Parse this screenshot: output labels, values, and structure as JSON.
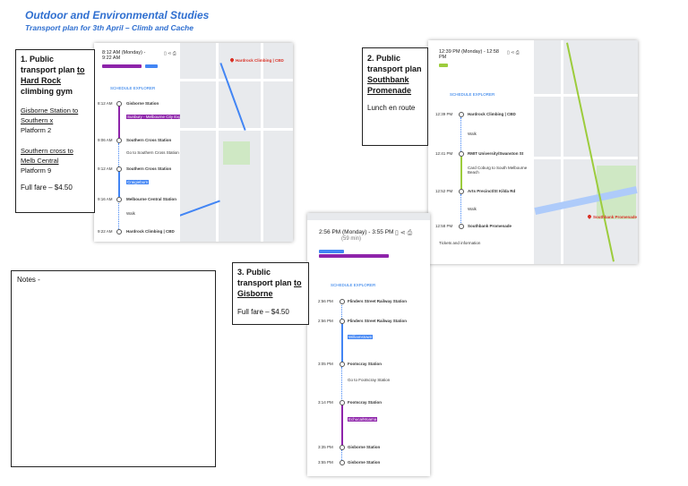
{
  "header": {
    "title": "Outdoor and Environmental Studies",
    "subtitle": "Transport plan for 3th April – Climb and Cache"
  },
  "box1": {
    "heading_a": "1. Public transport plan ",
    "heading_b": "to Hard Rock",
    "heading_c": "climbing gym",
    "leg1": "Gisborne Station to Southern x",
    "leg1_platform": "Platform 2",
    "leg2": "Southern cross to Melb Central",
    "leg2_platform": "Platform 9",
    "fare": "Full fare – $4.50"
  },
  "box2": {
    "heading_a": "2. Public transport plan ",
    "heading_b": "Southbank Promenade",
    "note": "Lunch en route"
  },
  "box3": {
    "heading_a": "3. Public transport plan ",
    "heading_b": "to Gisborne",
    "fare": "Full fare – $4.50"
  },
  "notes": {
    "label": "Notes -"
  },
  "shot1": {
    "time": "8:12 AM (Monday) - 9:22 AM",
    "schedule_label": "SCHEDULE EXPLORER",
    "stops": [
      {
        "time": "8:12 AM",
        "name": "Gisborne Station"
      },
      {
        "time": "",
        "name": "Sunbury - Melbourne City Express"
      },
      {
        "time": "9:06 AM",
        "name": "Southern Cross Station"
      },
      {
        "time": "",
        "name": "Go to Southern Cross Station"
      },
      {
        "time": "9:12 AM",
        "name": "Southern Cross Station"
      },
      {
        "time": "",
        "name": "Craigieburn"
      },
      {
        "time": "9:16 AM",
        "name": "Melbourne Central Station"
      },
      {
        "time": "",
        "name": "Walk"
      },
      {
        "time": "9:22 AM",
        "name": "Hardrock Climbing | CBD"
      }
    ],
    "map_label": "Hardrock Climbing | CBD"
  },
  "shot2": {
    "time": "12:39 PM (Monday) - 12:58 PM",
    "schedule_label": "SCHEDULE EXPLORER",
    "stops": [
      {
        "time": "12:39 PM",
        "name": "Hardrock Climbing | CBD"
      },
      {
        "time": "",
        "name": "Walk"
      },
      {
        "time": "12:41 PM",
        "name": "RMIT University/Swanston St"
      },
      {
        "time": "",
        "name": "Card Coburg to South Melbourne Beach"
      },
      {
        "time": "12:52 PM",
        "name": "Arts Precinct/St Kilda Rd"
      },
      {
        "time": "",
        "name": "Walk"
      },
      {
        "time": "12:58 PM",
        "name": "Southbank Promenade"
      }
    ],
    "footer": "Tickets and information",
    "map_label": "Southbank Promenade"
  },
  "shot3": {
    "time": "2:56 PM (Monday) - 3:55 PM",
    "duration": "(59 min)",
    "schedule_label": "SCHEDULE EXPLORER",
    "stops": [
      {
        "time": "2:56 PM",
        "name": "Flinders Street Railway Station"
      },
      {
        "time": "2:56 PM",
        "name": "Flinders Street Railway Station"
      },
      {
        "time": "",
        "name": "Williamstown"
      },
      {
        "time": "3:05 PM",
        "name": "Footscray Station"
      },
      {
        "time": "",
        "name": "Go to Footscray Station"
      },
      {
        "time": "3:14 PM",
        "name": "Footscray Station"
      },
      {
        "time": "",
        "name": "Echuca/Moama"
      },
      {
        "time": "3:35 PM",
        "name": "Gisborne Station"
      },
      {
        "time": "3:55 PM",
        "name": "Gisborne Station"
      }
    ]
  },
  "colors": {
    "title_blue": "#2f6fd0",
    "route_blue": "#4285f4",
    "purple": "#8e24aa",
    "green_line": "#9ccc3c"
  }
}
